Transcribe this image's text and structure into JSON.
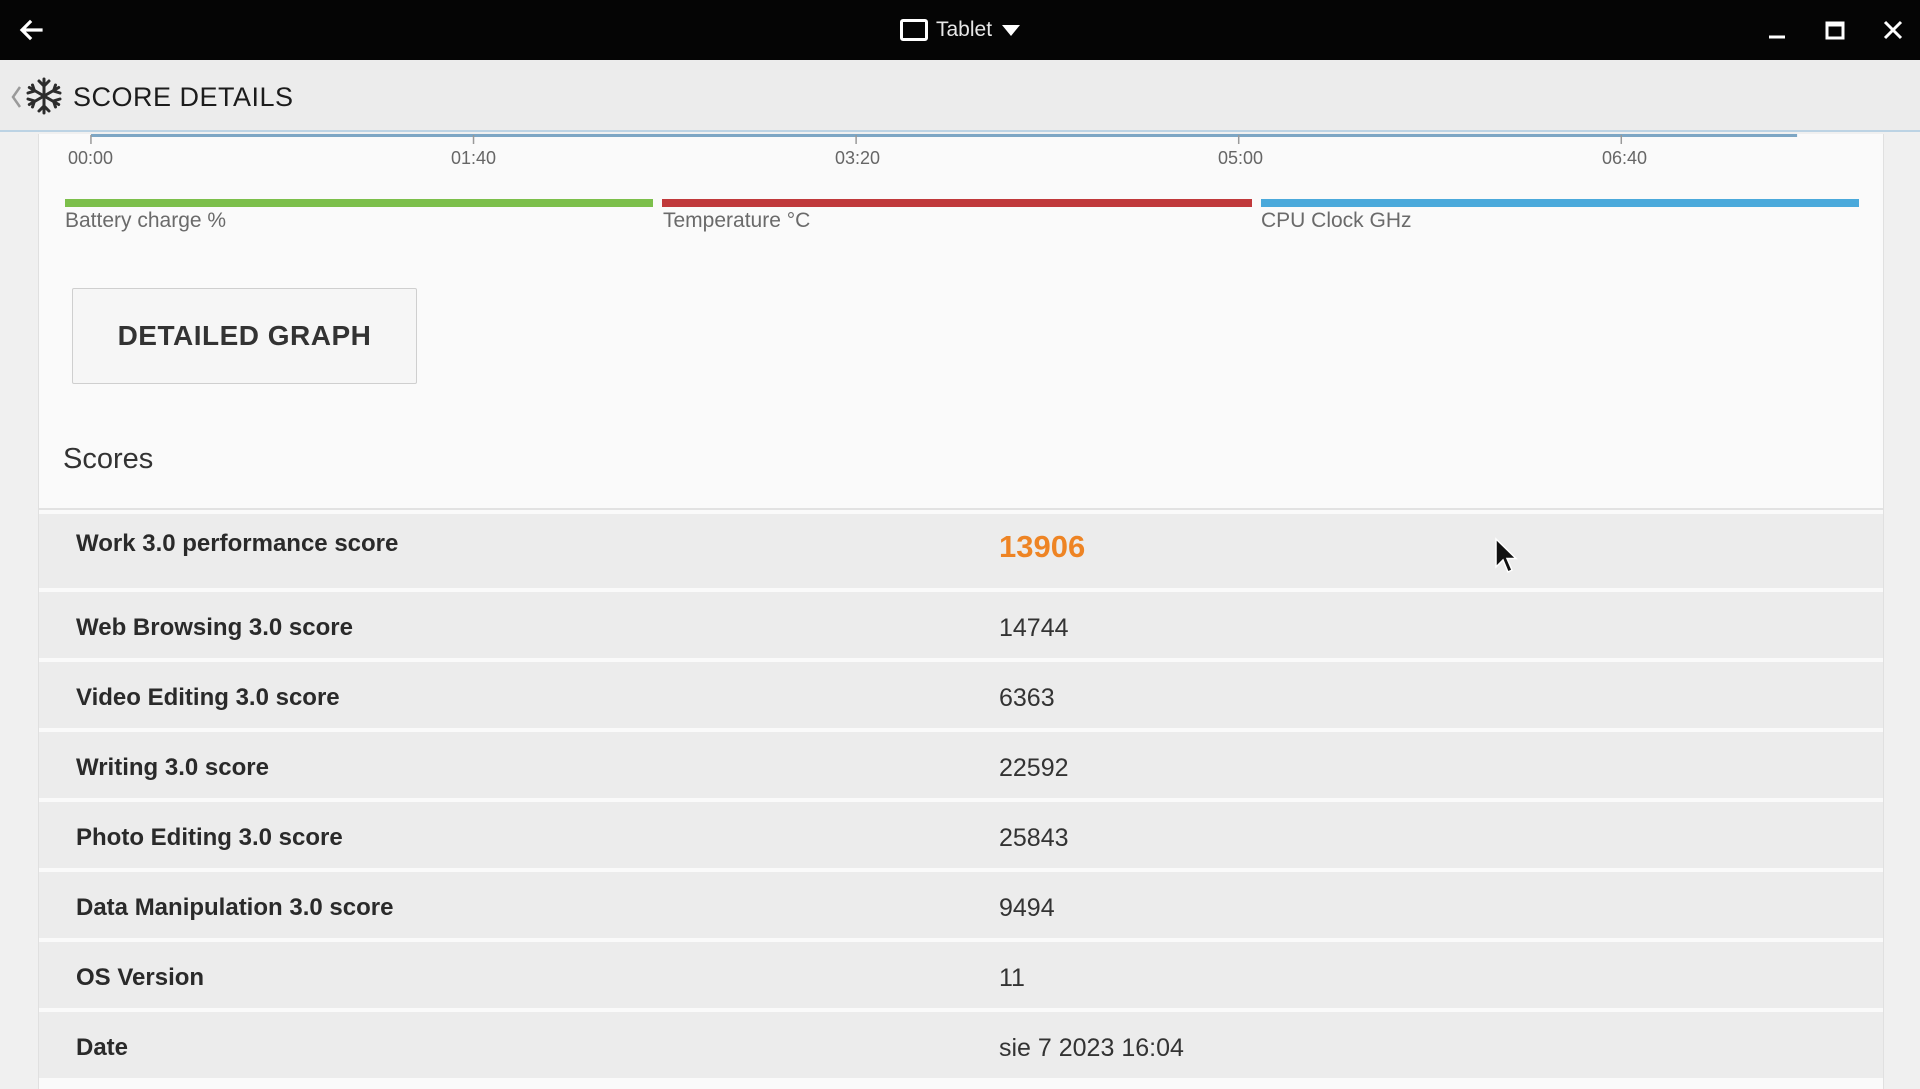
{
  "window": {
    "mode_label": "Tablet"
  },
  "header": {
    "title": "SCORE DETAILS"
  },
  "timeline": {
    "ticks": [
      "00:00",
      "01:40",
      "03:20",
      "05:00",
      "06:40"
    ]
  },
  "legend": {
    "items": [
      {
        "label": "Battery charge %",
        "color": "#7cbf4b"
      },
      {
        "label": "Temperature °C",
        "color": "#c0393b"
      },
      {
        "label": "CPU Clock GHz",
        "color": "#4aa9db"
      }
    ]
  },
  "detailed_graph_label": "DETAILED GRAPH",
  "scores": {
    "title": "Scores",
    "accent_color": "#ee8424",
    "rows": [
      {
        "label": "Work 3.0 performance score",
        "value": "13906"
      },
      {
        "label": "Web Browsing 3.0 score",
        "value": "14744"
      },
      {
        "label": "Video Editing 3.0 score",
        "value": "6363"
      },
      {
        "label": "Writing 3.0 score",
        "value": "22592"
      },
      {
        "label": "Photo Editing 3.0 score",
        "value": "25843"
      },
      {
        "label": "Data Manipulation 3.0 score",
        "value": "9494"
      },
      {
        "label": "OS Version",
        "value": "11"
      },
      {
        "label": "Date",
        "value": "sie 7 2023 16:04"
      }
    ]
  }
}
